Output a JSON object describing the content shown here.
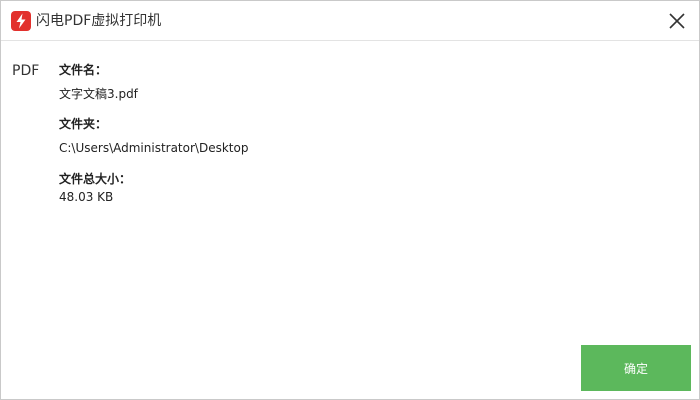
{
  "window": {
    "title": "闪电PDF虚拟打印机",
    "icon": "lightning-pdf-logo-icon",
    "close_icon": "close-icon"
  },
  "file": {
    "type": "PDF",
    "name_label": "文件名：",
    "name_value": "文字文稿3.pdf",
    "folder_label": "文件夹：",
    "folder_value": "C:\\Users\\Administrator\\Desktop",
    "size_label": "文件总大小：",
    "size_value": "48.03 KB"
  },
  "actions": {
    "ok_label": "确定"
  },
  "colors": {
    "brand": "#e2312d",
    "ok_button": "#5cb85c"
  }
}
